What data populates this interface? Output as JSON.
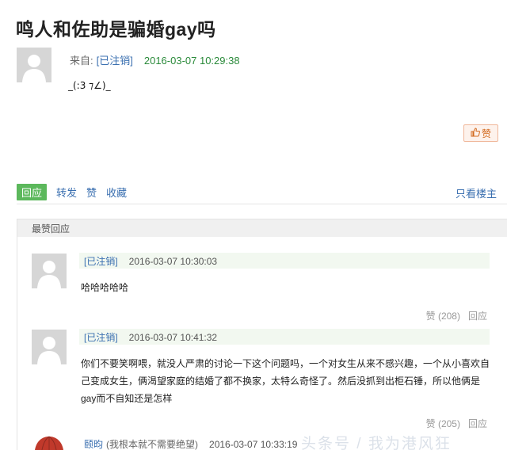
{
  "post": {
    "title": "鸣人和佐助是骗婚gay吗",
    "from_label": "来自:",
    "user": "[已注销]",
    "time": "2016-03-07 10:29:38",
    "text": "_(:3 ⁊∠)_",
    "like_label": "赞"
  },
  "actions": {
    "reply": "回应",
    "forward": "转发",
    "like": "赞",
    "collect": "收藏",
    "only_op": "只看楼主"
  },
  "section": {
    "title": "最赞回应"
  },
  "comments": [
    {
      "user": "[已注销]",
      "time": "2016-03-07 10:30:03",
      "text": "哈哈哈哈哈",
      "like": "赞 (208)",
      "reply": "回应"
    },
    {
      "user": "[已注销]",
      "time": "2016-03-07 10:41:32",
      "text": "你们不要笑啊喂，就没人严肃的讨论一下这个问题吗，一个对女生从来不感兴趣，一个从小喜欢自己变成女生，俩渴望家庭的结婚了都不换家，太特么奇怪了。然后没抓到出柜石锤，所以他俩是gay而不自知还是怎样",
      "like": "赞 (205)",
      "reply": "回应"
    },
    {
      "user": "颐昀",
      "note": "(我根本就不需要绝望)",
      "time": "2016-03-07 10:33:19"
    }
  ],
  "watermark": "头条号 / 我为港风狂"
}
